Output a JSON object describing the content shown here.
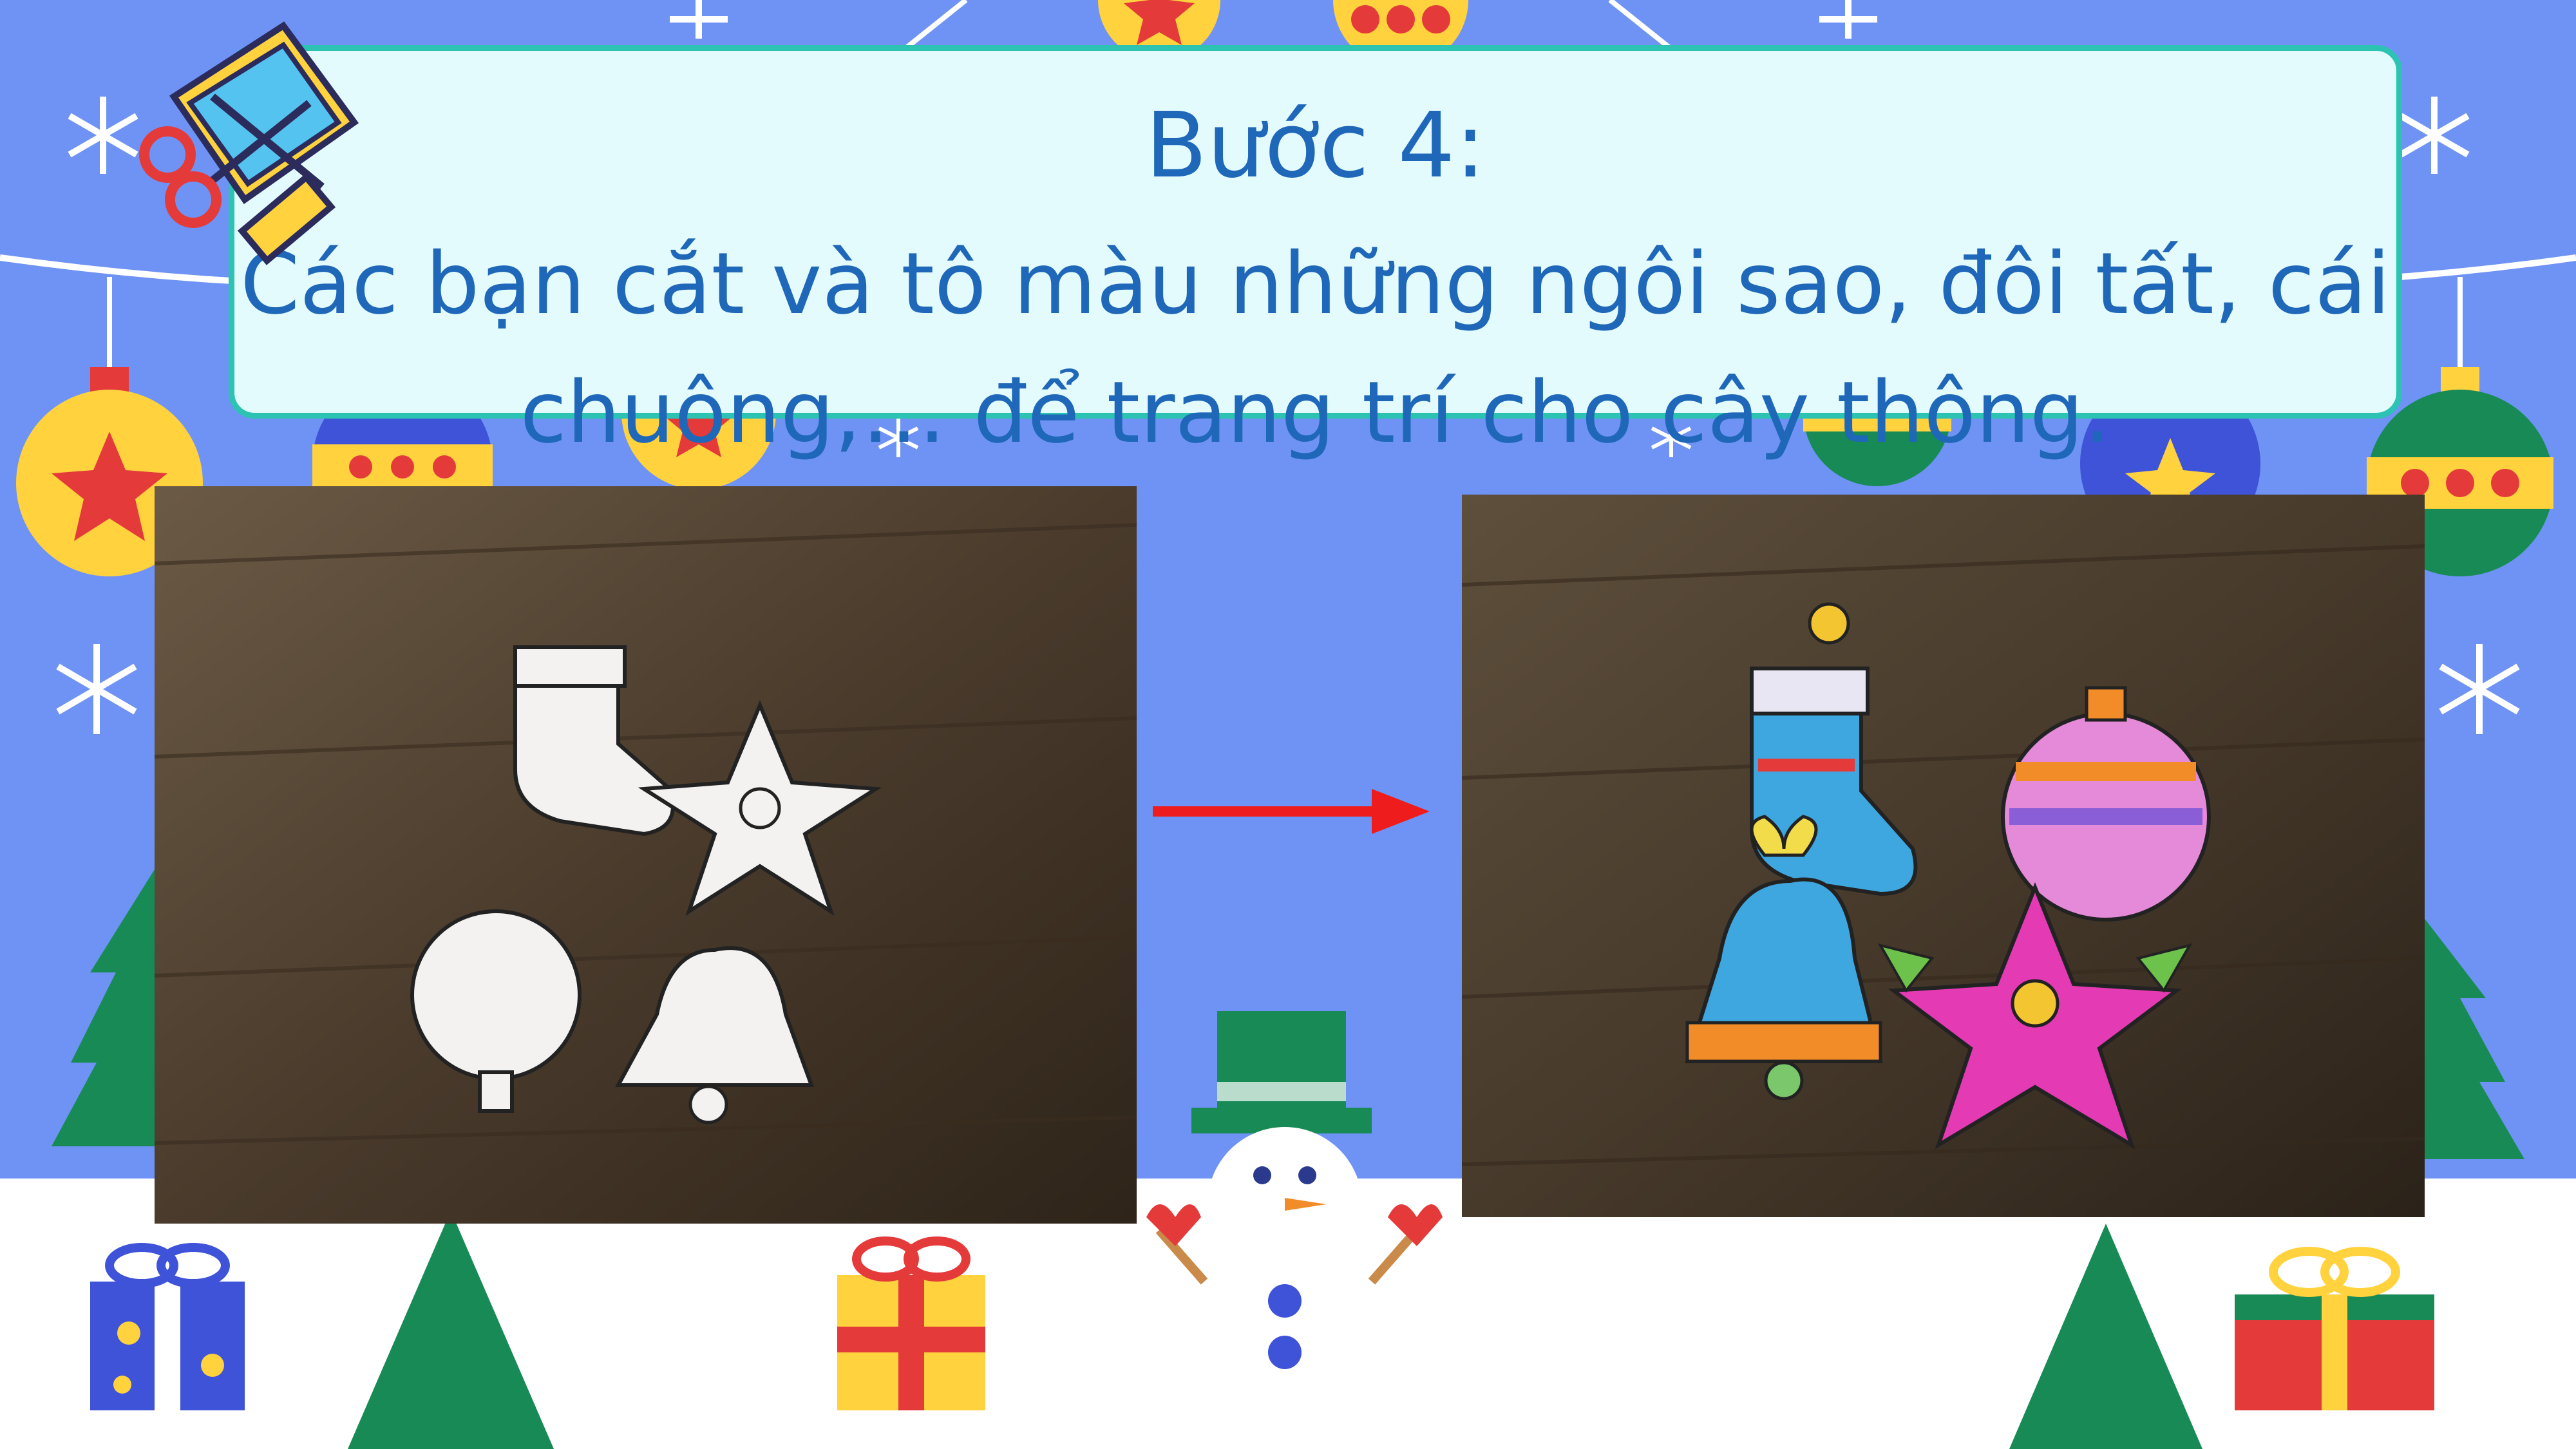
{
  "title": {
    "line1": "Bước 4:",
    "line2": "Các bạn cắt và tô màu những ngôi sao, đôi tất, cái chuông,… để trang trí cho cây thông."
  },
  "colors": {
    "background": "#6f93f4",
    "title_box": "#e3fbfd",
    "title_border": "#2cc3b2",
    "title_text": "#1f67b8",
    "arrow": "#ee1c1c"
  },
  "photos": {
    "before": "uncolored paper cutouts: stocking, poinsettia, ornament, bell",
    "after": "colored paper cutouts: stocking, ornament, bell, poinsettia"
  },
  "icons": [
    "scissors-icon",
    "snowflake-icon",
    "ornament-icon",
    "gift-icon",
    "christmas-tree-icon",
    "snowman-icon",
    "arrow-right-icon"
  ]
}
